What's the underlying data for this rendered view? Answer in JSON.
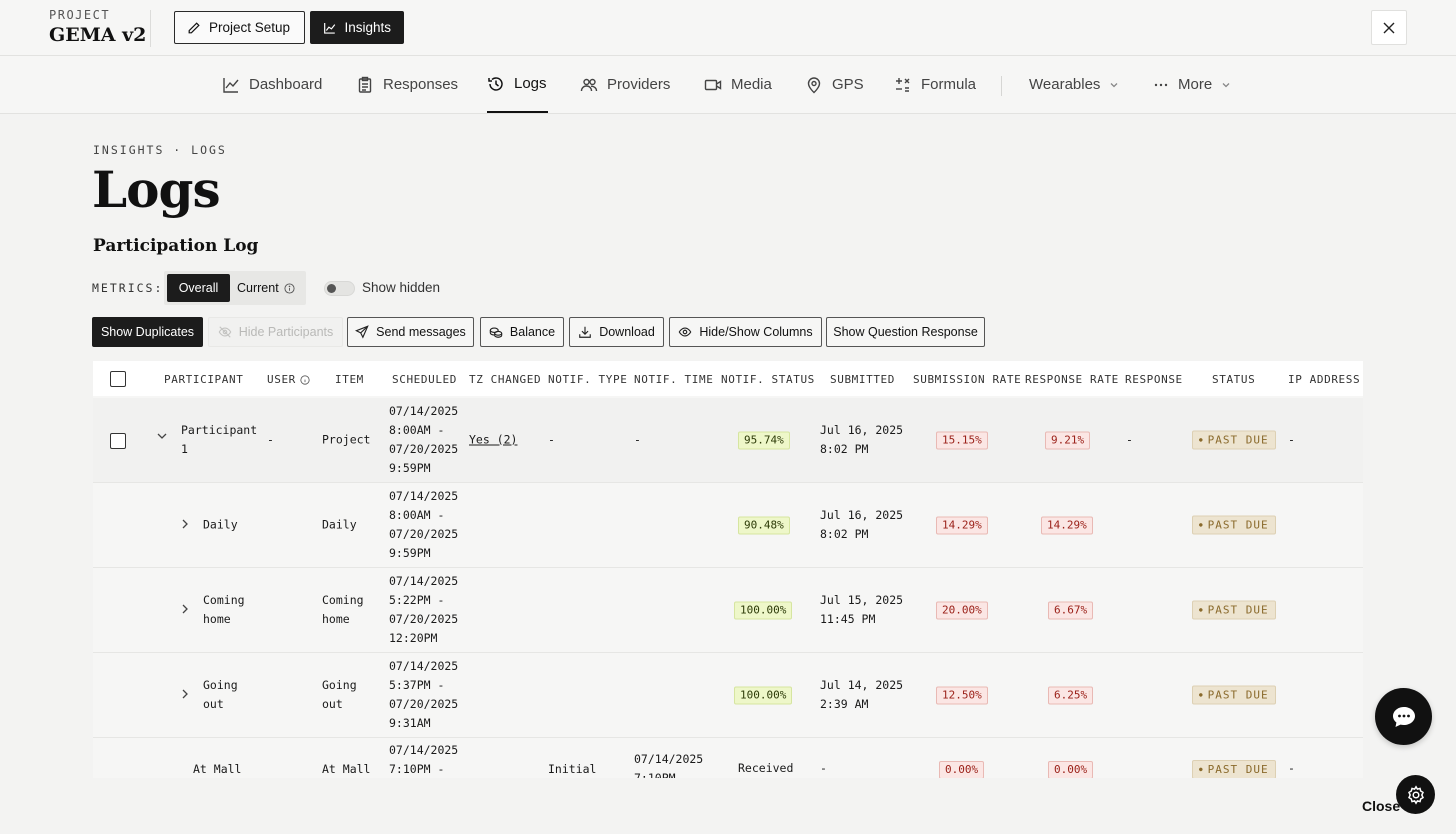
{
  "project": {
    "label": "PROJECT",
    "name": "GEMA v2"
  },
  "top_buttons": {
    "setup": "Project Setup",
    "insights": "Insights"
  },
  "nav": {
    "dashboard": "Dashboard",
    "responses": "Responses",
    "logs": "Logs",
    "providers": "Providers",
    "media": "Media",
    "gps": "GPS",
    "formula": "Formula",
    "wearables": "Wearables",
    "more": "More"
  },
  "breadcrumb": "INSIGHTS · LOGS",
  "page_title": "Logs",
  "section_title": "Participation Log",
  "metrics": {
    "label": "METRICS:",
    "overall": "Overall",
    "current": "Current"
  },
  "show_hidden": "Show hidden",
  "actions": {
    "show_duplicates": "Show Duplicates",
    "hide_participants": "Hide Participants",
    "send_messages": "Send messages",
    "balance": "Balance",
    "download": "Download",
    "hide_show_columns": "Hide/Show Columns",
    "show_question_response": "Show Question Response"
  },
  "table": {
    "headers": {
      "participant": "PARTICIPANT",
      "user": "USER",
      "item": "ITEM",
      "scheduled": "SCHEDULED",
      "tz_changed": "TZ CHANGED",
      "notif_type": "NOTIF. TYPE",
      "notif_time": "NOTIF. TIME",
      "notif_status": "NOTIF. STATUS",
      "submitted": "SUBMITTED",
      "submission_rate": "SUBMISSION RATE",
      "response_rate": "RESPONSE RATE",
      "response": "RESPONSE",
      "status": "STATUS",
      "ip_address": "IP ADDRESS"
    },
    "rows": [
      {
        "participant": "Participant 1",
        "user": "-",
        "item": "Project",
        "scheduled": "07/14/2025 8:00AM - 07/20/2025 9:59PM",
        "tz_changed": "Yes (2)",
        "notif_type": "-",
        "notif_time": "-",
        "notif_status": "95.74%",
        "submitted_date": "Jul 16, 2025",
        "submitted_time": "8:02 PM",
        "submission_rate": "15.15%",
        "response_rate": "9.21%",
        "response": "-",
        "status": "PAST DUE",
        "ip_address": "-"
      },
      {
        "participant": "Daily",
        "item": "Daily",
        "scheduled": "07/14/2025 8:00AM - 07/20/2025 9:59PM",
        "notif_status": "90.48%",
        "submitted_date": "Jul 16, 2025",
        "submitted_time": "8:02 PM",
        "submission_rate": "14.29%",
        "response_rate": "14.29%",
        "status": "PAST DUE"
      },
      {
        "participant": "Coming home",
        "item": "Coming home",
        "scheduled": "07/14/2025 5:22PM - 07/20/2025 12:20PM",
        "notif_status": "100.00%",
        "submitted_date": "Jul 15, 2025",
        "submitted_time": "11:45 PM",
        "submission_rate": "20.00%",
        "response_rate": "6.67%",
        "status": "PAST DUE"
      },
      {
        "participant": "Going out",
        "item": "Going out",
        "scheduled": "07/14/2025 5:37PM - 07/20/2025 9:31AM",
        "notif_status": "100.00%",
        "submitted_date": "Jul 14, 2025",
        "submitted_time": "2:39 AM",
        "submission_rate": "12.50%",
        "response_rate": "6.25%",
        "status": "PAST DUE"
      },
      {
        "participant": "At Mall",
        "item": "At Mall",
        "scheduled": "07/14/2025 7:10PM -",
        "notif_type": "Initial",
        "notif_time": "07/14/2025 7:10PM",
        "notif_status_text": "Received",
        "submitted_date": "-",
        "submission_rate": "0.00%",
        "response_rate": "0.00%",
        "status": "PAST DUE",
        "ip_address": "-"
      }
    ]
  },
  "footer": {
    "close": "Close"
  },
  "colors": {
    "dark": "#1c1c1c",
    "green_pill": "#eef7c9",
    "red_pill": "#fbe6e4",
    "status_pill": "#ede4d0"
  }
}
